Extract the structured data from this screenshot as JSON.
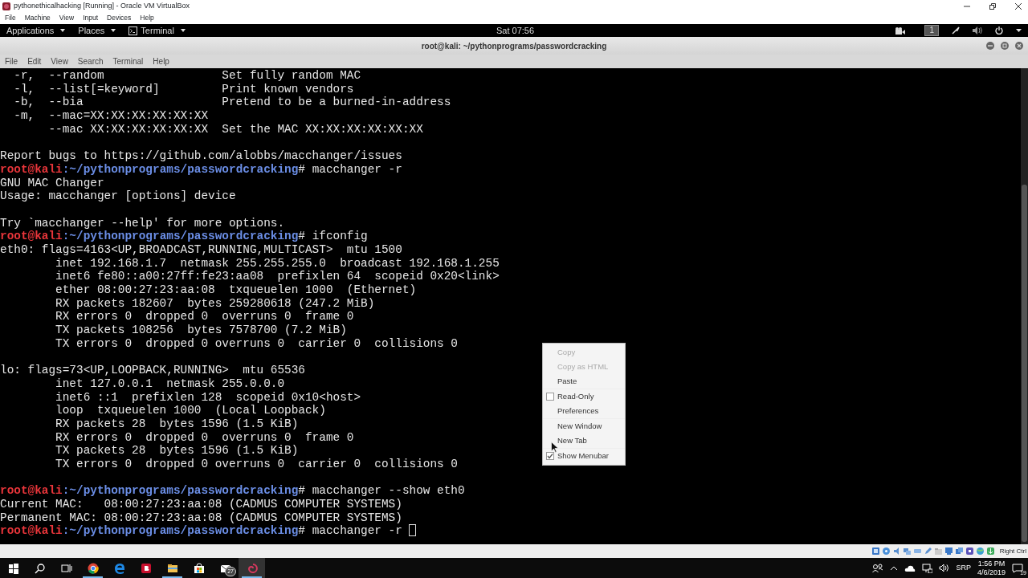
{
  "host_window": {
    "title": "pythonethicalhacking [Running] - Oracle VM VirtualBox",
    "menu": [
      "File",
      "Machine",
      "View",
      "Input",
      "Devices",
      "Help"
    ],
    "status_key": "Right Ctrl"
  },
  "top_bar": {
    "menus": [
      {
        "label": "Applications",
        "kind": "text"
      },
      {
        "label": "Places",
        "kind": "text"
      },
      {
        "label": "Terminal",
        "kind": "terminal"
      }
    ],
    "clock": "Sat 07:56",
    "workspace": "1"
  },
  "terminal": {
    "title": "root@kali: ~/pythonprograms/passwordcracking",
    "menu": [
      "File",
      "Edit",
      "View",
      "Search",
      "Terminal",
      "Help"
    ],
    "lines": [
      {
        "kind": "output",
        "text": "  -r,  --random                 Set fully random MAC"
      },
      {
        "kind": "output",
        "text": "  -l,  --list[=keyword]         Print known vendors"
      },
      {
        "kind": "output",
        "text": "  -b,  --bia                    Pretend to be a burned-in-address"
      },
      {
        "kind": "output",
        "text": "  -m,  --mac=XX:XX:XX:XX:XX:XX"
      },
      {
        "kind": "output",
        "text": "       --mac XX:XX:XX:XX:XX:XX  Set the MAC XX:XX:XX:XX:XX:XX"
      },
      {
        "kind": "blank"
      },
      {
        "kind": "output",
        "text": "Report bugs to https://github.com/alobbs/macchanger/issues"
      },
      {
        "kind": "prompt",
        "host": "root@kali",
        "path": ":~/pythonprograms/passwordcracking",
        "command": "# macchanger -r"
      },
      {
        "kind": "output",
        "text": "GNU MAC Changer"
      },
      {
        "kind": "output",
        "text": "Usage: macchanger [options] device"
      },
      {
        "kind": "blank"
      },
      {
        "kind": "output",
        "text": "Try `macchanger --help' for more options."
      },
      {
        "kind": "prompt",
        "host": "root@kali",
        "path": ":~/pythonprograms/passwordcracking",
        "command": "# ifconfig"
      },
      {
        "kind": "output",
        "text": "eth0: flags=4163<UP,BROADCAST,RUNNING,MULTICAST>  mtu 1500"
      },
      {
        "kind": "output",
        "text": "        inet 192.168.1.7  netmask 255.255.255.0  broadcast 192.168.1.255"
      },
      {
        "kind": "output",
        "text": "        inet6 fe80::a00:27ff:fe23:aa08  prefixlen 64  scopeid 0x20<link>"
      },
      {
        "kind": "output",
        "text": "        ether 08:00:27:23:aa:08  txqueuelen 1000  (Ethernet)"
      },
      {
        "kind": "output",
        "text": "        RX packets 182607  bytes 259280618 (247.2 MiB)"
      },
      {
        "kind": "output",
        "text": "        RX errors 0  dropped 0  overruns 0  frame 0"
      },
      {
        "kind": "output",
        "text": "        TX packets 108256  bytes 7578700 (7.2 MiB)"
      },
      {
        "kind": "output",
        "text": "        TX errors 0  dropped 0 overruns 0  carrier 0  collisions 0"
      },
      {
        "kind": "blank"
      },
      {
        "kind": "output",
        "text": "lo: flags=73<UP,LOOPBACK,RUNNING>  mtu 65536"
      },
      {
        "kind": "output",
        "text": "        inet 127.0.0.1  netmask 255.0.0.0"
      },
      {
        "kind": "output",
        "text": "        inet6 ::1  prefixlen 128  scopeid 0x10<host>"
      },
      {
        "kind": "output",
        "text": "        loop  txqueuelen 1000  (Local Loopback)"
      },
      {
        "kind": "output",
        "text": "        RX packets 28  bytes 1596 (1.5 KiB)"
      },
      {
        "kind": "output",
        "text": "        RX errors 0  dropped 0  overruns 0  frame 0"
      },
      {
        "kind": "output",
        "text": "        TX packets 28  bytes 1596 (1.5 KiB)"
      },
      {
        "kind": "output",
        "text": "        TX errors 0  dropped 0 overruns 0  carrier 0  collisions 0"
      },
      {
        "kind": "blank"
      },
      {
        "kind": "prompt",
        "host": "root@kali",
        "path": ":~/pythonprograms/passwordcracking",
        "command": "# macchanger --show eth0"
      },
      {
        "kind": "output",
        "text": "Current MAC:   08:00:27:23:aa:08 (CADMUS COMPUTER SYSTEMS)"
      },
      {
        "kind": "output",
        "text": "Permanent MAC: 08:00:27:23:aa:08 (CADMUS COMPUTER SYSTEMS)"
      },
      {
        "kind": "prompt",
        "host": "root@kali",
        "path": ":~/pythonprograms/passwordcracking",
        "command": "# macchanger -r",
        "cursor": true
      }
    ]
  },
  "context_menu": {
    "items": [
      {
        "kind": "item",
        "label": "Copy",
        "disabled": true
      },
      {
        "kind": "item",
        "label": "Copy as HTML",
        "disabled": true
      },
      {
        "kind": "item",
        "label": "Paste",
        "disabled": false
      },
      {
        "kind": "separator"
      },
      {
        "kind": "check",
        "label": "Read-Only",
        "checked": false
      },
      {
        "kind": "item",
        "label": "Preferences",
        "disabled": false
      },
      {
        "kind": "separator"
      },
      {
        "kind": "item",
        "label": "New Window",
        "disabled": false
      },
      {
        "kind": "item",
        "label": "New Tab",
        "disabled": false
      },
      {
        "kind": "separator"
      },
      {
        "kind": "check",
        "label": "Show Menubar",
        "checked": true
      }
    ]
  },
  "taskbar": {
    "apps": [
      {
        "kind": "chrome",
        "running": true,
        "selected": false
      },
      {
        "kind": "edge",
        "running": false,
        "selected": false
      },
      {
        "kind": "b-app",
        "running": false,
        "selected": false
      },
      {
        "kind": "folder",
        "running": true,
        "selected": false
      },
      {
        "kind": "store",
        "running": false,
        "selected": false
      },
      {
        "kind": "mail",
        "running": false,
        "selected": false,
        "badge": "27"
      },
      {
        "kind": "swirl",
        "running": true,
        "selected": true
      }
    ],
    "tray": {
      "language": "SRP",
      "time": "1:56 PM",
      "date": "4/6/2019",
      "notifications": "19"
    }
  }
}
